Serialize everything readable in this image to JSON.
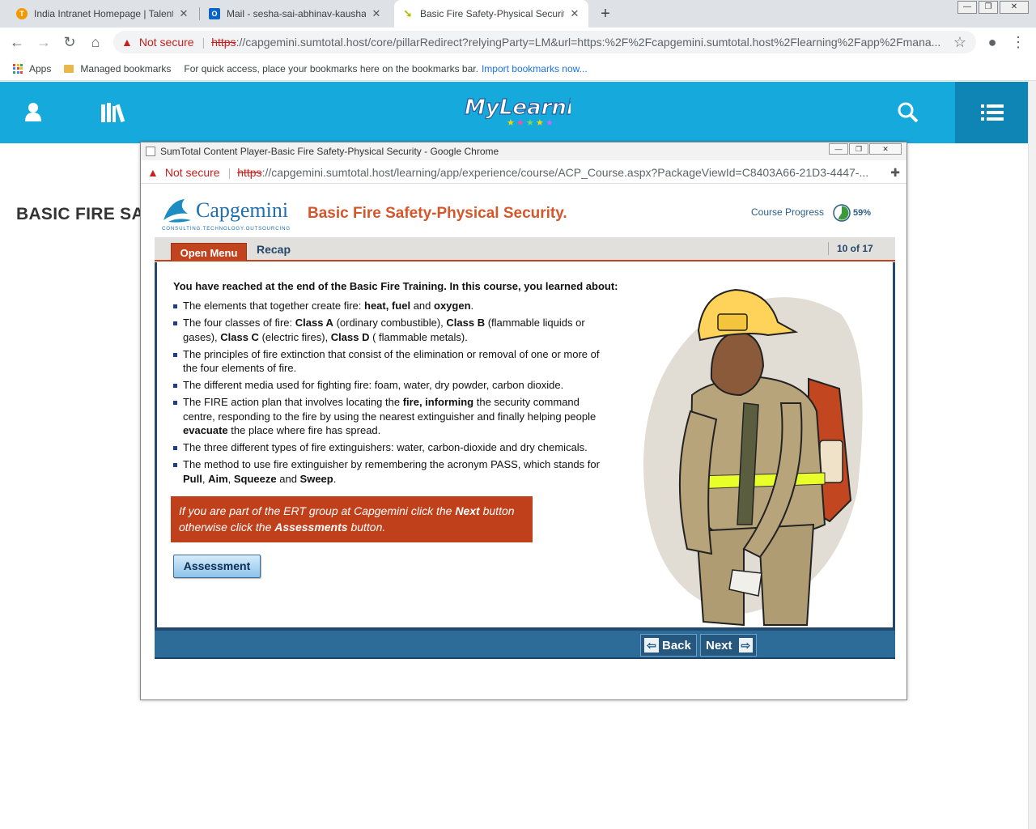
{
  "browser": {
    "tabs": [
      {
        "title": "India Intranet Homepage | Talent",
        "favicon": "talent-logo-icon",
        "color": "#f29900"
      },
      {
        "title": "Mail - sesha-sai-abhinav-kaushal",
        "favicon": "outlook-icon",
        "color": "#0a64c8"
      },
      {
        "title": "Basic Fire Safety-Physical Security",
        "favicon": "sumtotal-icon",
        "color": "#c8c800"
      }
    ],
    "security": "Not secure",
    "url_scheme": "https",
    "url_rest": "://capgemini.sumtotal.host/core/pillarRedirect?relyingParty=LM&url=https:%2F%2Fcapgemini.sumtotal.host%2Flearning%2Fapp%2Fmana...",
    "bookmarks": {
      "apps": "Apps",
      "managed": "Managed bookmarks",
      "hint": "For quick access, place your bookmarks here on the bookmarks bar.",
      "import_link": "Import bookmarks now..."
    }
  },
  "mylearning": {
    "logo_text": "MyLearning",
    "page_title_partial": "BASIC FIRE SAI",
    "header_color": "#16aadc"
  },
  "popup": {
    "window_title": "SumTotal Content Player-Basic Fire Safety-Physical Security - Google Chrome",
    "security": "Not secure",
    "url_scheme": "https",
    "url_rest": "://capgemini.sumtotal.host/learning/app/experience/course/ACP_Course.aspx?PackageViewId=C8403A66-21D3-4447-..."
  },
  "course": {
    "brand": "Capgemini",
    "brand_tagline": "CONSULTING.TECHNOLOGY.OUTSOURCING",
    "title": "Basic Fire Safety-Physical Security.",
    "progress_label": "Course Progress",
    "progress_value": "59%",
    "progress_fraction": 0.59,
    "menu_button": "Open Menu",
    "section": "Recap",
    "page_indicator": "10 of 17",
    "intro": "You have reached at the end of the Basic Fire Training. In this course, you learned about:",
    "bullets": [
      {
        "parts": [
          [
            "The elements that together create fire: ",
            false
          ],
          [
            "heat, fuel",
            true
          ],
          [
            " and ",
            false
          ],
          [
            "oxygen",
            true
          ],
          [
            ".",
            false
          ]
        ]
      },
      {
        "parts": [
          [
            "The four classes of fire: ",
            false
          ],
          [
            "Class A",
            true
          ],
          [
            " (ordinary combustible), ",
            false
          ],
          [
            "Class B",
            true
          ],
          [
            " (flammable liquids or gases), ",
            false
          ],
          [
            "Class C",
            true
          ],
          [
            " (electric fires), ",
            false
          ],
          [
            "Class D",
            true
          ],
          [
            " ( flammable metals).",
            false
          ]
        ]
      },
      {
        "parts": [
          [
            "The principles of fire extinction that consist of the elimination or removal of one or more of the four elements of fire.",
            false
          ]
        ]
      },
      {
        "parts": [
          [
            "The different media used for fighting fire: foam, water, dry powder, carbon dioxide.",
            false
          ]
        ]
      },
      {
        "parts": [
          [
            "The FIRE action plan that involves locating the ",
            false
          ],
          [
            "fire, informing",
            true
          ],
          [
            " the security command centre, responding to the fire by using the nearest extinguisher and finally helping people ",
            false
          ],
          [
            "evacuate",
            true
          ],
          [
            " the place where fire has spread.",
            false
          ]
        ]
      },
      {
        "parts": [
          [
            "The three different types of fire extinguishers: water, carbon-dioxide and dry chemicals.",
            false
          ]
        ]
      },
      {
        "parts": [
          [
            "The method to use fire extinguisher by remembering the acronym PASS, which stands for ",
            false
          ],
          [
            "Pull",
            true
          ],
          [
            ", ",
            false
          ],
          [
            "Aim",
            true
          ],
          [
            ", ",
            false
          ],
          [
            "Squeeze",
            true
          ],
          [
            " and ",
            false
          ],
          [
            "Sweep",
            true
          ],
          [
            ".",
            false
          ]
        ]
      }
    ],
    "notice_parts": [
      [
        "If you are part of the ERT group at Capgemini click the ",
        false
      ],
      [
        "Next",
        true
      ],
      [
        " button otherwise click the ",
        false
      ],
      [
        "Assessments",
        true
      ],
      [
        " button.",
        false
      ]
    ],
    "assessment_button": "Assessment",
    "back_button": "Back",
    "next_button": "Next",
    "accent_color": "#c1441e",
    "nav_color": "#2d6b99"
  }
}
